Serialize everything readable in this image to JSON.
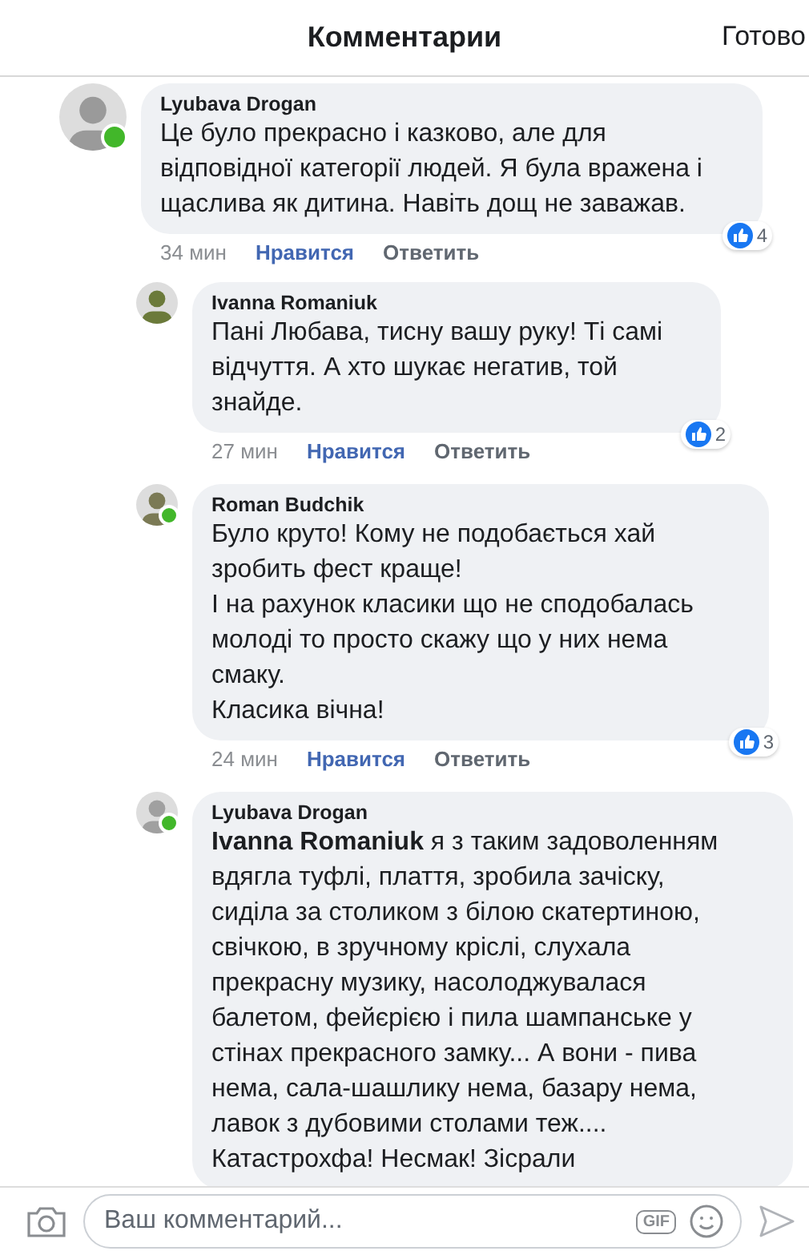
{
  "header": {
    "title": "Комментарии",
    "done": "Готово"
  },
  "comments": [
    {
      "author": "Lyubava Drogan",
      "online": true,
      "reply": false,
      "text": "Це було прекрасно і казково, але для\nвідповідної категорії людей. Я була вражена і\nщаслива як дитина. Навіть дощ не заважав.",
      "time": "34 мин",
      "like": "Нравится",
      "answer": "Ответить",
      "reactions": "4"
    },
    {
      "author": "Ivanna Romaniuk",
      "online": false,
      "reply": true,
      "text": "Пані Любава, тисну вашу руку! Ті самі\nвідчуття. А хто шукає негатив, той\nзнайде.",
      "time": "27 мин",
      "like": "Нравится",
      "answer": "Ответить",
      "reactions": "2"
    },
    {
      "author": "Roman Budchik",
      "online": true,
      "reply": true,
      "text": "Було круто! Кому не подобається хай\nзробить фест краще!\nІ на рахунок класики що не сподобалась\nмолоді то просто скажу що у них нема\nсмаку.\nКласика вічна!",
      "time": "24 мин",
      "like": "Нравится",
      "answer": "Ответить",
      "reactions": "3"
    },
    {
      "author": "Lyubava Drogan",
      "online": true,
      "reply": true,
      "text": "**Ivanna Romaniuk** я з таким задоволенням\nвдягла туфлі, плаття, зробила зачіску,\nсиділа за столиком з білою скатертиною,\nсвічкою, в зручному кріслі, слухала\nпрекрасну музику, насолоджувалася\nбалетом, фейєрією і пила шампанське у\nстінах прекрасного замку... А вони - пива\nнема, сала-шашлику нема, базару нема,\nлавок з дубовими столами теж....\nКатастрохфа! Несмак! Зісрали"
    }
  ],
  "composer": {
    "placeholder": "Ваш комментарий...",
    "gif": "GIF"
  }
}
